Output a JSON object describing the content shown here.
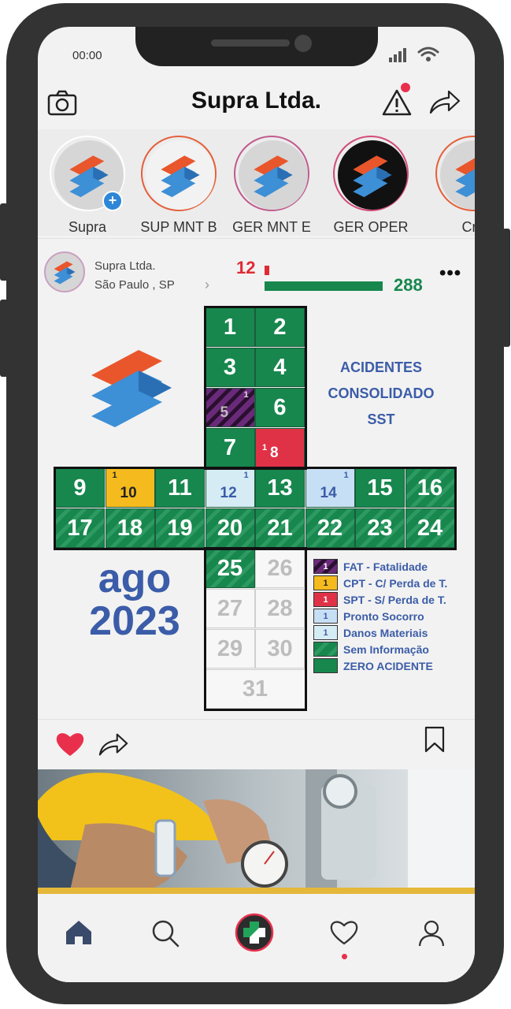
{
  "status_bar": {
    "time": "00:00"
  },
  "header": {
    "title": "Supra Ltda."
  },
  "stories": [
    {
      "label": "Supra",
      "ring": "#ffffff",
      "bg": "#d6d6d6",
      "add": true
    },
    {
      "label": "SUP MNT B",
      "ring": "#e4603a",
      "bg": "#f2f2f2",
      "add": false
    },
    {
      "label": "GER MNT E",
      "ring": "#c15a8e",
      "bg": "#d6d6d6",
      "add": false
    },
    {
      "label": "GER OPER",
      "ring": "#d24a7a",
      "bg": "#111111",
      "add": false
    },
    {
      "label": "Cra",
      "ring": "#e4603a",
      "bg": "#d6d6d6",
      "add": false
    }
  ],
  "post": {
    "account": "Supra Ltda.",
    "location": "São Paulo ,  SP",
    "accidents_count": "12",
    "zero_accident_count": "288"
  },
  "calendar": {
    "title_lines": [
      "ACIDENTES",
      "CONSOLIDADO",
      "SST"
    ],
    "month": "ago",
    "year": "2023",
    "days": [
      {
        "day": "1",
        "kind": "zero",
        "count": ""
      },
      {
        "day": "2",
        "kind": "zero",
        "count": ""
      },
      {
        "day": "3",
        "kind": "zero",
        "count": ""
      },
      {
        "day": "4",
        "kind": "zero",
        "count": ""
      },
      {
        "day": "5",
        "kind": "fat",
        "count": "1"
      },
      {
        "day": "6",
        "kind": "zero",
        "count": ""
      },
      {
        "day": "7",
        "kind": "zero",
        "count": ""
      },
      {
        "day": "8",
        "kind": "spt",
        "count": "1"
      },
      {
        "day": "9",
        "kind": "zero",
        "count": ""
      },
      {
        "day": "10",
        "kind": "cpt",
        "count": "1"
      },
      {
        "day": "11",
        "kind": "zero",
        "count": ""
      },
      {
        "day": "12",
        "kind": "dm",
        "count": "1"
      },
      {
        "day": "13",
        "kind": "zero",
        "count": ""
      },
      {
        "day": "14",
        "kind": "ps",
        "count": "1"
      },
      {
        "day": "15",
        "kind": "zero",
        "count": ""
      },
      {
        "day": "16",
        "kind": "none",
        "count": ""
      },
      {
        "day": "17",
        "kind": "none",
        "count": ""
      },
      {
        "day": "18",
        "kind": "none",
        "count": ""
      },
      {
        "day": "19",
        "kind": "none",
        "count": ""
      },
      {
        "day": "20",
        "kind": "none",
        "count": ""
      },
      {
        "day": "21",
        "kind": "none",
        "count": ""
      },
      {
        "day": "22",
        "kind": "none",
        "count": ""
      },
      {
        "day": "23",
        "kind": "none",
        "count": ""
      },
      {
        "day": "24",
        "kind": "none",
        "count": ""
      },
      {
        "day": "25",
        "kind": "none",
        "count": ""
      },
      {
        "day": "26",
        "kind": "empty",
        "count": ""
      },
      {
        "day": "27",
        "kind": "empty",
        "count": ""
      },
      {
        "day": "28",
        "kind": "empty",
        "count": ""
      },
      {
        "day": "29",
        "kind": "empty",
        "count": ""
      },
      {
        "day": "30",
        "kind": "empty",
        "count": ""
      },
      {
        "day": "31",
        "kind": "empty",
        "count": ""
      }
    ],
    "legend": [
      {
        "kind": "fat",
        "count": "1",
        "label": "FAT - Fatalidade"
      },
      {
        "kind": "cpt",
        "count": "1",
        "label": "CPT - C/ Perda de T."
      },
      {
        "kind": "spt",
        "count": "1",
        "label": "SPT - S/ Perda de T."
      },
      {
        "kind": "ps",
        "count": "1",
        "label": "Pronto Socorro"
      },
      {
        "kind": "dm",
        "count": "1",
        "label": "Danos Materiais"
      },
      {
        "kind": "none",
        "count": "",
        "label": "Sem Informação"
      },
      {
        "kind": "zero",
        "count": "",
        "label": "ZERO ACIDENTE"
      }
    ],
    "colors": {
      "zero": "#17874e",
      "fat": "#6a2a7a",
      "cpt": "#f5bb1e",
      "spt": "#e03247",
      "ps": "#c7dff4",
      "dm": "#d5ecf5",
      "title": "#3b5ca8"
    }
  },
  "icons": {
    "header_left": "camera-icon",
    "header_right": [
      "alert-icon",
      "share-icon"
    ],
    "post_actions": [
      "heart-icon",
      "share-icon",
      "bookmark-icon"
    ],
    "nav": [
      "home-icon",
      "search-icon",
      "safety-cross-icon",
      "heart-icon",
      "profile-icon"
    ]
  }
}
